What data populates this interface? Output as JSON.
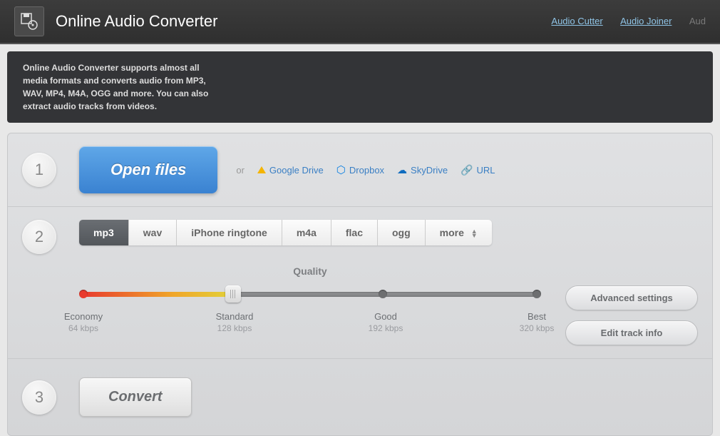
{
  "header": {
    "title": "Online Audio Converter",
    "links": {
      "cutter": "Audio Cutter",
      "joiner": "Audio Joiner",
      "cutoff": "Aud"
    }
  },
  "description": "Online Audio Converter supports almost all media formats and converts audio from MP3, WAV, MP4, M4A, OGG and more. You can also extract audio tracks from videos.",
  "step1": {
    "num": "1",
    "open_label": "Open files",
    "or": "or",
    "sources": {
      "gdrive": "Google Drive",
      "dropbox": "Dropbox",
      "skydrive": "SkyDrive",
      "url": "URL"
    }
  },
  "step2": {
    "num": "2",
    "formats": {
      "mp3": "mp3",
      "wav": "wav",
      "ringtone": "iPhone ringtone",
      "m4a": "m4a",
      "flac": "flac",
      "ogg": "ogg",
      "more": "more"
    },
    "quality_label": "Quality",
    "scale": [
      {
        "name": "Economy",
        "rate": "64 kbps"
      },
      {
        "name": "Standard",
        "rate": "128 kbps"
      },
      {
        "name": "Good",
        "rate": "192 kbps"
      },
      {
        "name": "Best",
        "rate": "320 kbps"
      }
    ],
    "advanced": "Advanced settings",
    "track_info": "Edit track info"
  },
  "step3": {
    "num": "3",
    "convert": "Convert"
  }
}
